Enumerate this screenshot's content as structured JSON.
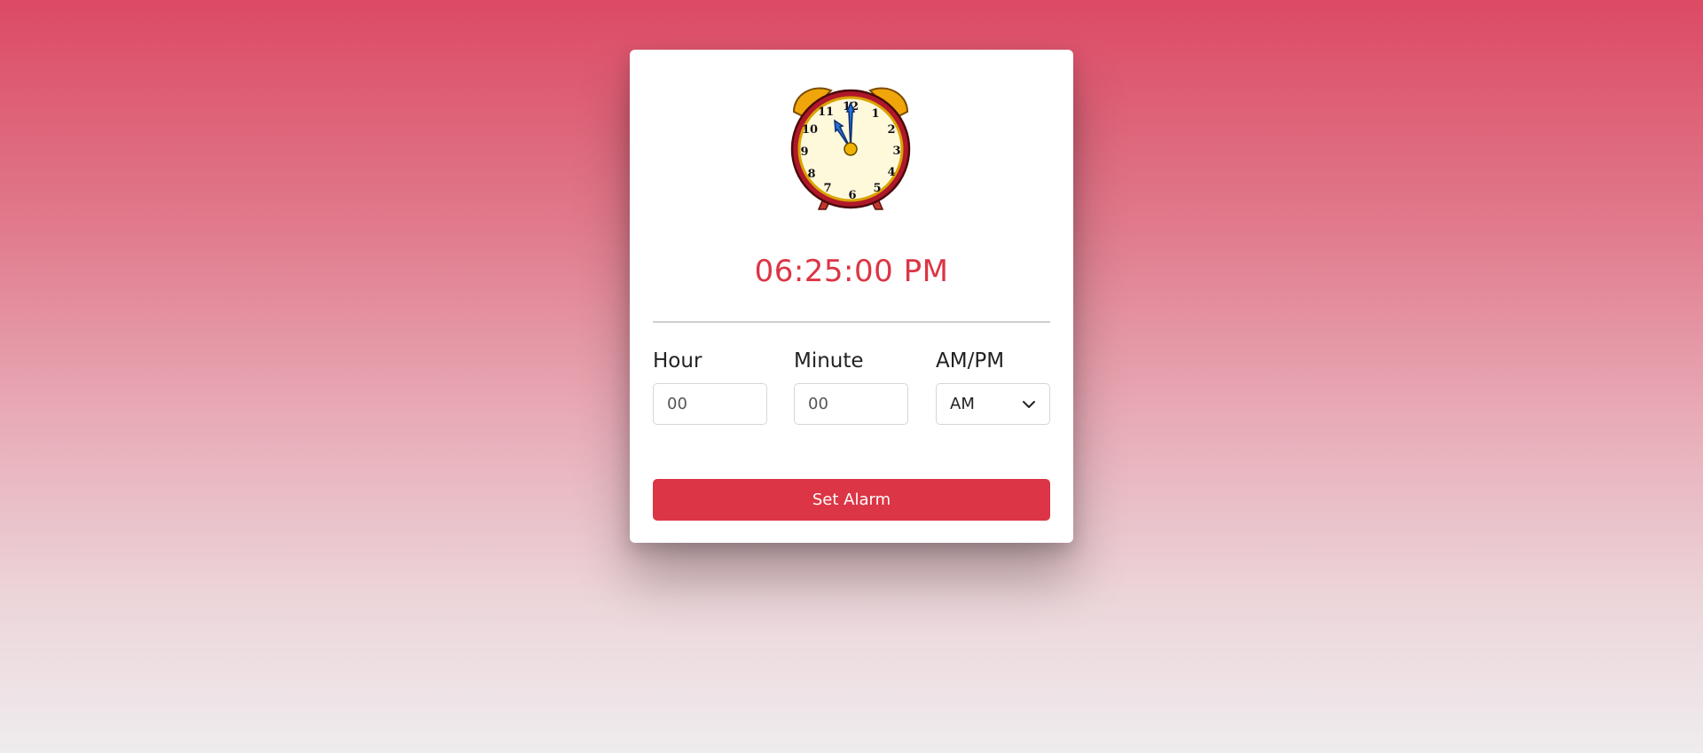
{
  "clock": {
    "icon": "alarm-clock-icon",
    "numerals": [
      "12",
      "1",
      "2",
      "3",
      "4",
      "5",
      "6",
      "7",
      "8",
      "9",
      "10",
      "11"
    ]
  },
  "current_time": "06:25:00 PM",
  "form": {
    "hour": {
      "label": "Hour",
      "placeholder": "00"
    },
    "minute": {
      "label": "Minute",
      "placeholder": "00"
    },
    "ampm": {
      "label": "AM/PM",
      "selected": "AM"
    }
  },
  "set_alarm_label": "Set Alarm",
  "colors": {
    "accent": "#dc3545",
    "card": "#ffffff"
  }
}
